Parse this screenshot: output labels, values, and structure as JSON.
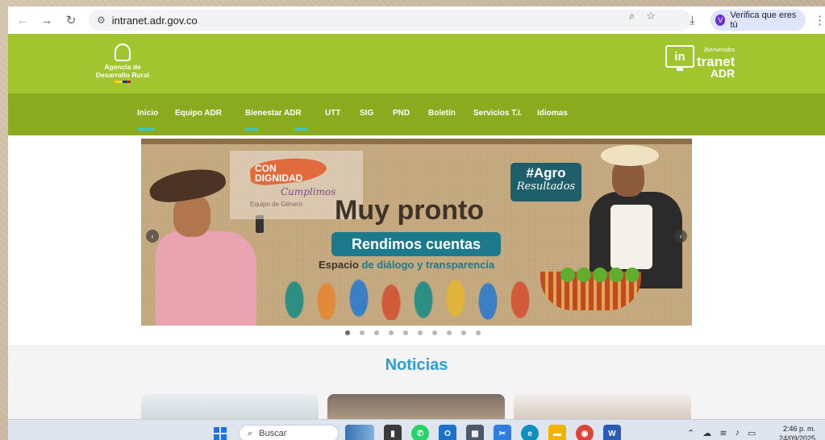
{
  "browser": {
    "url": "intranet.adr.gov.co",
    "verify_chip": "Verifica que eres tú",
    "verify_initial": "V"
  },
  "header": {
    "logo_text_line1": "Agencia de",
    "logo_text_line2": "Desarrollo Rural",
    "intranet_welcome": "Bienvenidos",
    "intranet_in": "in",
    "intranet_word": "tranet",
    "intranet_adr": "ADR"
  },
  "nav": {
    "items": [
      "Inicio",
      "Equipo ADR",
      "Bienestar ADR",
      "UTT",
      "SIG",
      "PND",
      "Boletín",
      "Servicios T.I.",
      "Idiomas"
    ]
  },
  "banner": {
    "dignidad_line1": "CON",
    "dignidad_line2": "DIGNIDAD",
    "cumplimos": "Cumplimos",
    "equipo": "Equipo de Género",
    "agro_line1": "#Agro",
    "agro_line2": "Resultados",
    "title": "Muy pronto",
    "subtitle": "Rendimos cuentas",
    "tagline_part1": "Espacio ",
    "tagline_part2": "de diálogo y transparencia",
    "slide_count": 10,
    "active_slide": 1
  },
  "news": {
    "title": "Noticias"
  },
  "taskbar": {
    "search": "Buscar",
    "time": "2:46 p. m.",
    "date": "24/09/2025"
  },
  "colors": {
    "header_green": "#a1c52e",
    "nav_green": "#8aab1f",
    "nav_underline": "#3cc3d6",
    "news_title": "#2d9ed6",
    "rendimos_teal": "#1c7a8c"
  }
}
